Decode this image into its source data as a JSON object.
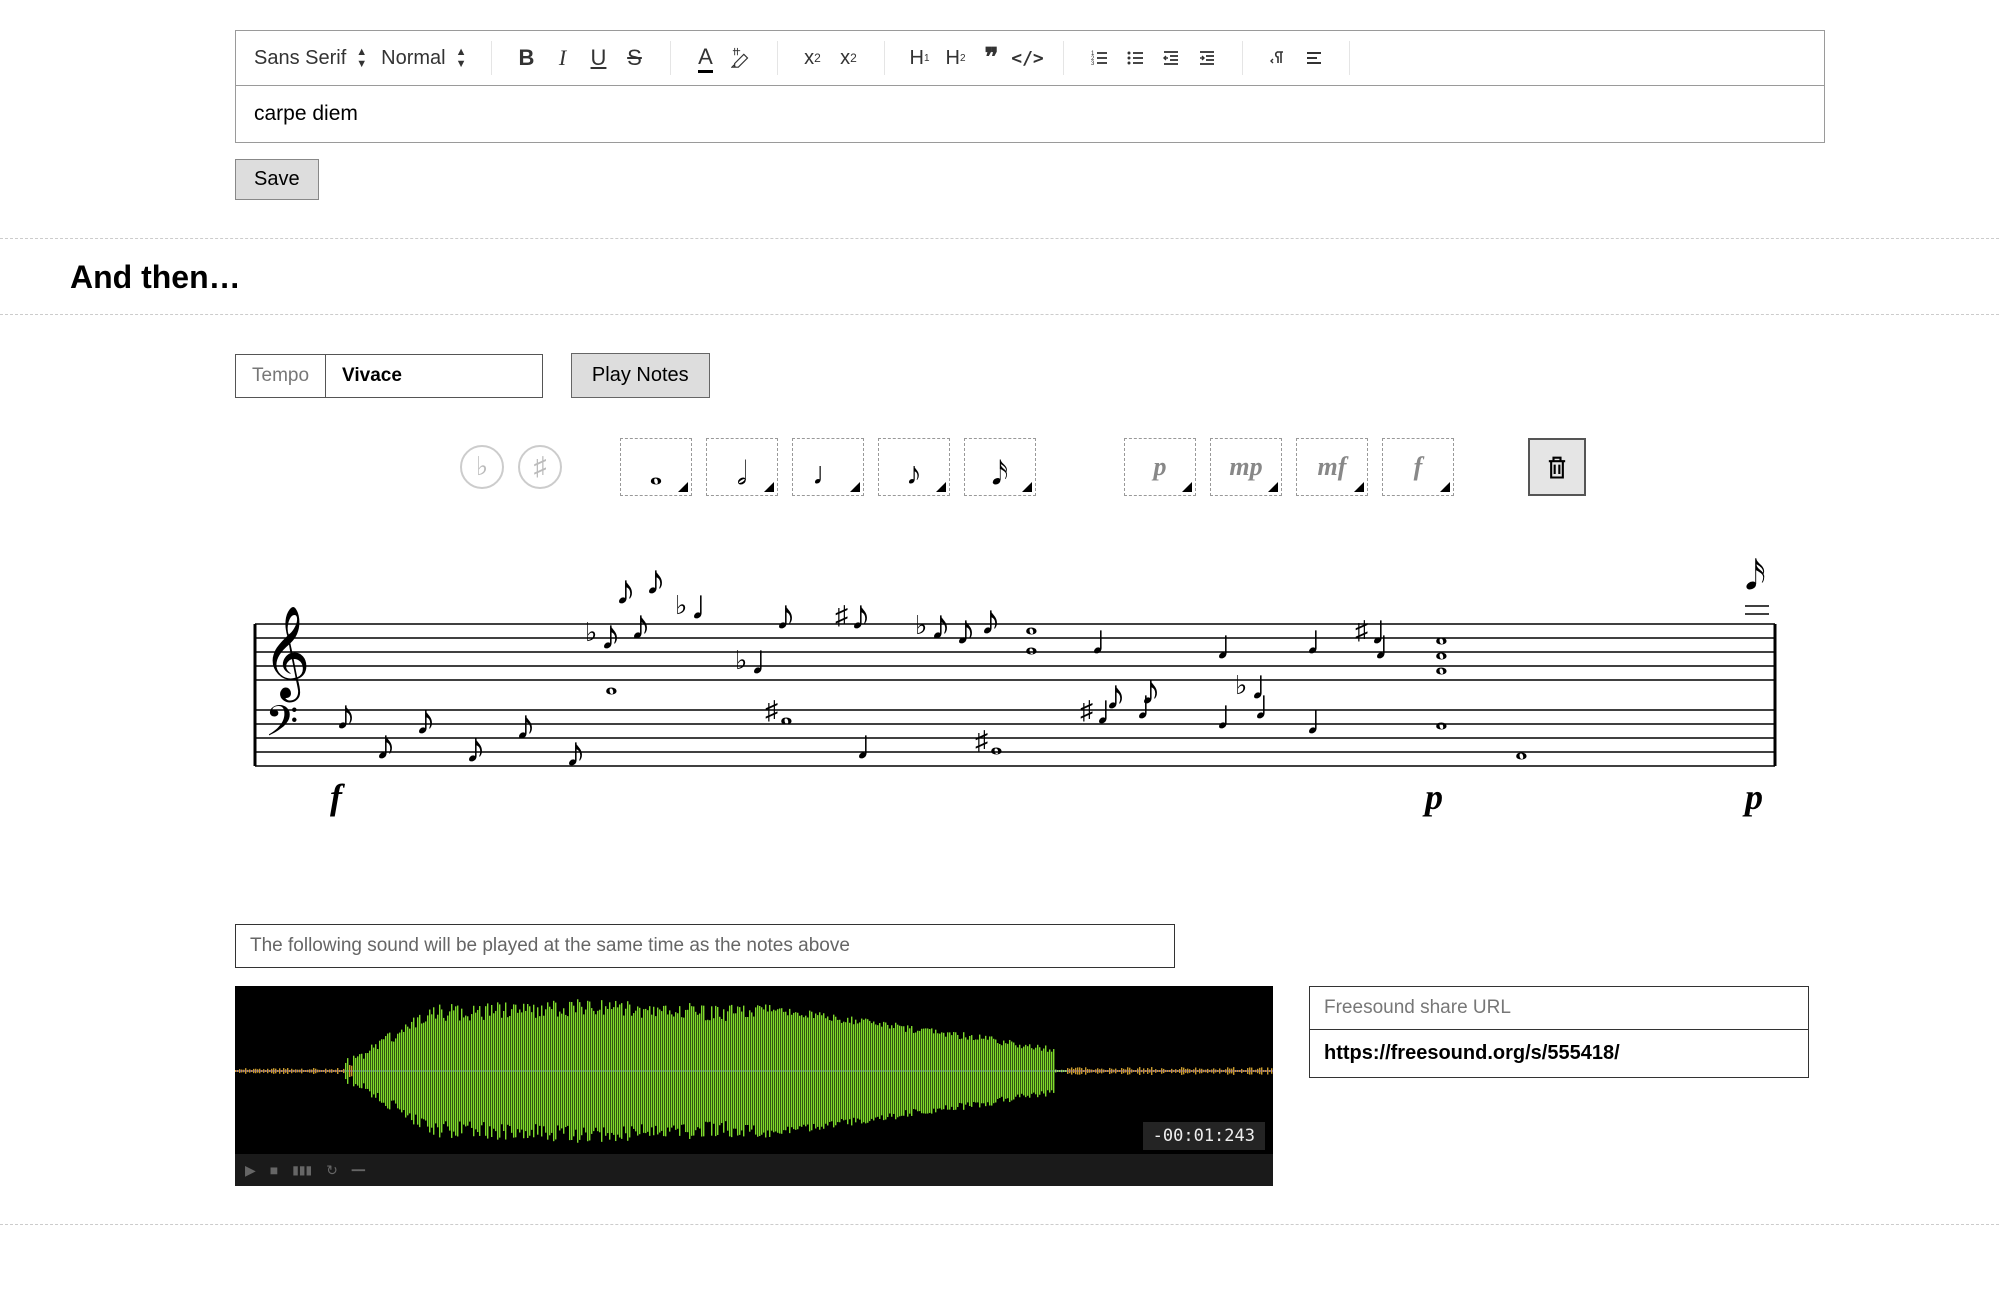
{
  "toolbar": {
    "font_family": "Sans Serif",
    "font_size": "Normal"
  },
  "editor": {
    "content": "carpe diem"
  },
  "buttons": {
    "save": "Save",
    "play_notes": "Play Notes"
  },
  "section": {
    "title": "And then…"
  },
  "tempo": {
    "label": "Tempo",
    "value": "Vivace"
  },
  "music_toolbar": {
    "dynamics": [
      "p",
      "mp",
      "mf",
      "f"
    ]
  },
  "staff_dynamics": {
    "d1": "f",
    "d2": "p",
    "d3": "p"
  },
  "sound": {
    "caption": "The following sound will be played at the same time as the notes above",
    "time": "-00:01:243"
  },
  "freesound": {
    "label": "Freesound share URL",
    "url": "https://freesound.org/s/555418/"
  }
}
